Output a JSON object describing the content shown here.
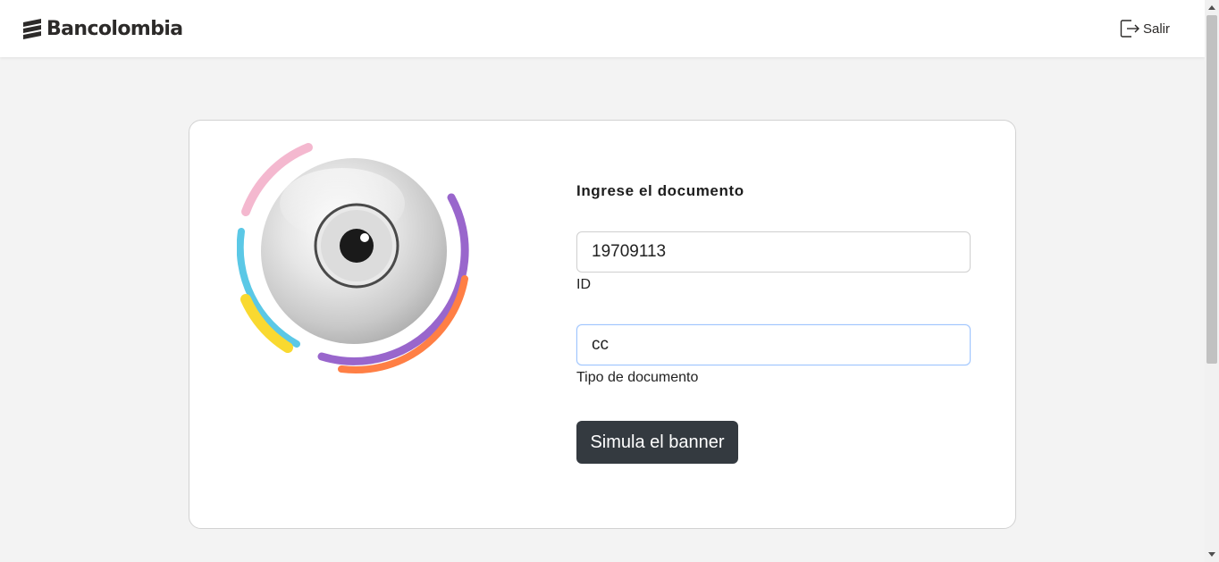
{
  "header": {
    "logo_text": "Bancolombia",
    "logout_label": "Salir"
  },
  "form": {
    "title": "Ingrese el documento",
    "id_value": "19709113",
    "id_label": "ID",
    "doc_type_value": "cc",
    "doc_type_label": "Tipo de documento",
    "submit_label": "Simula el banner"
  },
  "icons": {
    "logo": "bancolombia-logo-icon",
    "logout": "logout-icon",
    "illustration": "eye-illustration"
  },
  "colors": {
    "header_bg": "#ffffff",
    "page_bg": "#f3f3f3",
    "button_bg": "#343a40",
    "ring_pink": "#f4b8cf",
    "ring_cyan": "#5bc8e6",
    "ring_yellow": "#f9d930",
    "ring_purple": "#9966cc",
    "ring_orange": "#ff7f45"
  }
}
